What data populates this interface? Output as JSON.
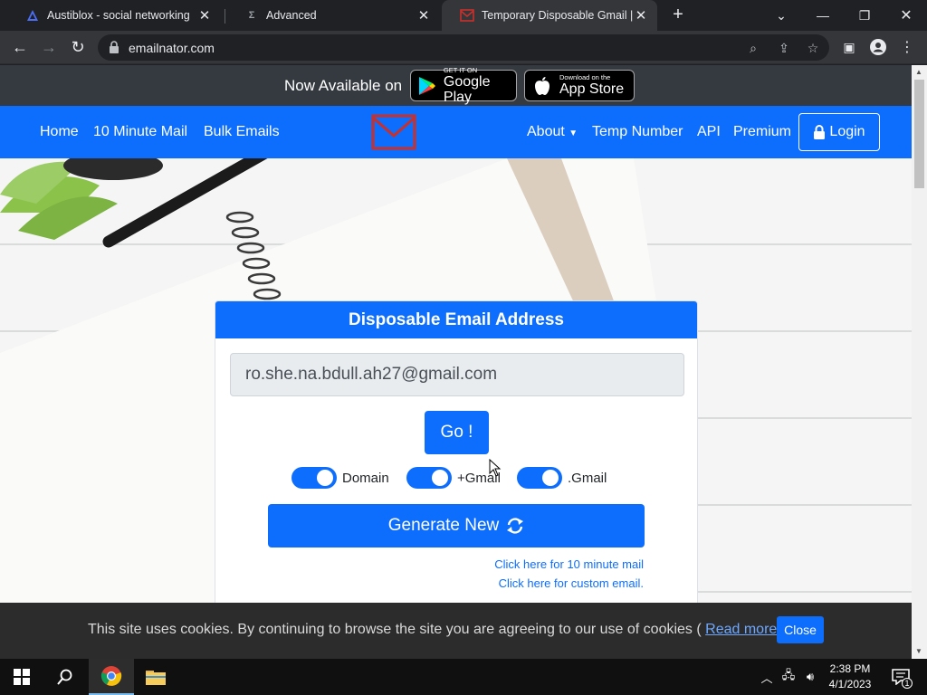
{
  "browser": {
    "tabs": [
      {
        "title": "Austiblox - social networking",
        "active": false
      },
      {
        "title": "Advanced",
        "active": false
      },
      {
        "title": "Temporary Disposable Gmail | Te",
        "active": true
      }
    ],
    "url": "emailnator.com"
  },
  "promo": {
    "text": "Now Available on",
    "google_play": {
      "small": "GET IT ON",
      "big": "Google Play"
    },
    "app_store": {
      "small": "Download on the",
      "big": "App Store"
    }
  },
  "nav": {
    "left": [
      "Home",
      "10 Minute Mail",
      "Bulk Emails"
    ],
    "about": "About",
    "temp_number": "Temp Number",
    "api": "API",
    "premium": "Premium",
    "login": "Login"
  },
  "card": {
    "title": "Disposable Email Address",
    "email": "ro.she.na.bdull.ah27@gmail.com",
    "go": "Go !",
    "toggles": [
      {
        "label": "Domain",
        "on": true
      },
      {
        "label": "+Gmail",
        "on": true
      },
      {
        "label": ".Gmail",
        "on": true
      }
    ],
    "generate": "Generate New",
    "link_10min": "Click here for 10 minute mail",
    "link_custom": "Click here for custom email."
  },
  "cookie": {
    "text": "This site uses cookies. By continuing to browse the site you are agreeing to our use of cookies (",
    "read_more": "Read more",
    "text_end": ")",
    "close": "Close"
  },
  "taskbar": {
    "time": "2:38 PM",
    "date": "4/1/2023",
    "notifications": "1"
  },
  "colors": {
    "primary": "#0d6efd",
    "dark_bar": "#343a40",
    "chrome_bg": "#202124"
  }
}
